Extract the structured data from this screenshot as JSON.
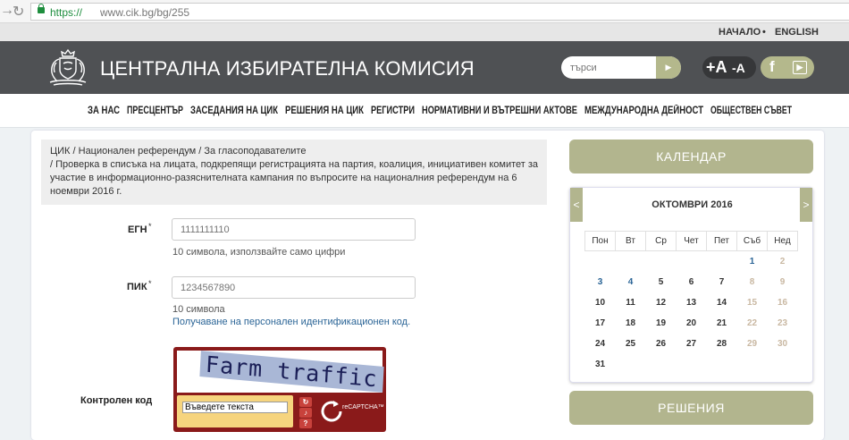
{
  "browser": {
    "url_scheme": "https://",
    "url_rest": "www.cik.bg/bg/255"
  },
  "toplinks": {
    "home": "НАЧАЛО",
    "sep": "•",
    "english": "ENGLISH"
  },
  "header": {
    "title": "ЦЕНТРАЛНА ИЗБИРАТЕЛНА КОМИСИЯ",
    "search_placeholder": "търси",
    "font_large": "+A",
    "font_small": "-A"
  },
  "nav": [
    "ЗА НАС",
    "ПРЕСЦЕНТЪР",
    "ЗАСЕДАНИЯ НА ЦИК",
    "РЕШЕНИЯ НА ЦИК",
    "РЕГИСТРИ",
    "НОРМАТИВНИ И ВЪТРЕШНИ АКТОВЕ",
    "МЕЖДУНАРОДНА ДЕЙНОСТ",
    "ОБЩЕСТВЕН СЪВЕТ"
  ],
  "breadcrumb": {
    "line1": "ЦИК /  Национален референдум /  За гласоподавателите",
    "line2": " /  Проверка в списъка на лицата, подкрепящи регистрацията на партия, коалиция, инициативен комитет за",
    "line3": "участие в информационно-разяснителната кампания по въпросите на националния референдум на 6",
    "line4": "ноември 2016 г."
  },
  "form": {
    "egn_label": "ЕГН",
    "egn_placeholder": "1111111110",
    "egn_hint": "10 символа, използвайте само цифри",
    "pik_label": "ПИК",
    "pik_placeholder": "1234567890",
    "pik_hint": "10 символа",
    "pik_link": "Получаване на персонален идентификационен код.",
    "required_mark": "*",
    "captcha_label": "Контролен код",
    "captcha_word": "Farm traffic",
    "captcha_value": "Въведете текста",
    "recaptcha_brand": "reCAPTCHA™"
  },
  "sidebar": {
    "calendar_button": "КАЛЕНДАР",
    "decisions_button": "РЕШЕНИЯ"
  },
  "calendar": {
    "month": "ОКТОМВРИ 2016",
    "prev": "<",
    "next": ">",
    "weekdays": [
      "Пон",
      "Вт",
      "Ср",
      "Чет",
      "Пет",
      "Съб",
      "Нед"
    ],
    "weeks": [
      [
        "",
        "",
        "",
        "",
        "",
        "1",
        "2"
      ],
      [
        "3",
        "4",
        "5",
        "6",
        "7",
        "8",
        "9"
      ],
      [
        "10",
        "11",
        "12",
        "13",
        "14",
        "15",
        "16"
      ],
      [
        "17",
        "18",
        "19",
        "20",
        "21",
        "22",
        "23"
      ],
      [
        "24",
        "25",
        "26",
        "27",
        "28",
        "29",
        "30"
      ],
      [
        "31",
        "",
        "",
        "",
        "",
        "",
        ""
      ]
    ],
    "event_days": [
      "1",
      "3",
      "4"
    ]
  },
  "colors": {
    "olive": "#b2b58e",
    "banner": "#4f5154",
    "link": "#2a6496",
    "captcha_frame": "#8a1a1a"
  }
}
